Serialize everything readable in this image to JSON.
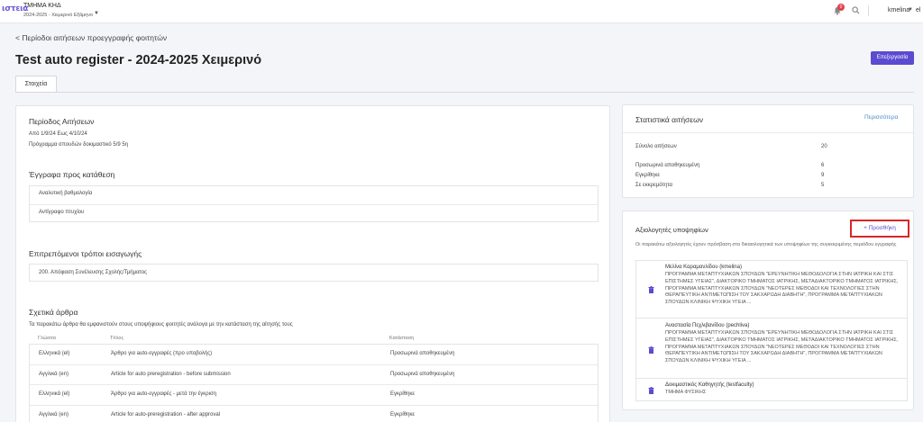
{
  "topnav": {
    "logo": "ιστεια",
    "department": "ΤΜΗΜΑ ΚΗΔ",
    "period": "2024-2025 - Χειμερινό Εξάμηνο",
    "notifications": "0",
    "username": "kmelina",
    "user_extra": "el",
    "icons": {
      "bell": "bell-icon",
      "search": "search-icon"
    }
  },
  "page": {
    "back_link": "Περίοδοι αιτήσεων προεγγραφής φοιτητών",
    "title": "Test auto register - 2024-2025 Χειμερινό",
    "action_button": "Επεξεργασία",
    "tab": "Στοιχεία"
  },
  "left": {
    "period_title": "Περίοδος Αιτήσεων",
    "period_dates": "Από 1/9/24 Εως 4/10/24",
    "program": "Πρόγραμμα σπουδών δοκιμαστικό 5/9 5η",
    "docs_title": "Έγγραφα προς κατάθεση",
    "docs": [
      "Αναλυτική βαθμολογία",
      "Αντίγραφο πτυχίου"
    ],
    "entry_title": "Επιτρεπόμενοι τρόποι εισαγωγής",
    "entry_items": [
      "200. Απόφαση Συνέλευσης Σχολής/Τμήματος"
    ],
    "articles_title": "Σχετικά άρθρα",
    "articles_desc": "Τα παρακάτω άρθρα θα εμφανιστούν στους υποψήφιους φοιτητές ανάλογα με την κατάσταση της αίτησής τους",
    "articles_headers": [
      "Γλώσσα",
      "Τίτλος",
      "Κατάσταση"
    ],
    "articles": [
      [
        "Ελληνικά (el)",
        "Άρθρο για auto-εγγραφές (προ υποβολής)",
        "Προσωρινά αποθηκευμένη"
      ],
      [
        "Αγγλικά (en)",
        "Article for auto preregistration - before submission",
        "Προσωρινά αποθηκευμένη"
      ],
      [
        "Ελληνικά (el)",
        "Άρθρο για auto-εγγραφές - μετά την έγκριση",
        "Εγκρίθηκε"
      ],
      [
        "Αγγλικά (en)",
        "Article for auto-preregistration - after approval",
        "Εγκρίθηκε"
      ]
    ]
  },
  "stats": {
    "title": "Στατιστικά αιτήσεων",
    "more": "Περισσότερα",
    "rows": [
      {
        "label": "Σύνολο αιτήσεων",
        "value": "20"
      },
      {
        "label": "Προσωρινά αποθηκευμένη",
        "value": "6"
      },
      {
        "label": "Εγκρίθηκε",
        "value": "9"
      },
      {
        "label": "Σε εκκρεμότητα",
        "value": "5"
      }
    ]
  },
  "evaluators": {
    "title": "Αξιολογητές υποψηφίων",
    "add": "+ Προσθήκη",
    "desc": "Οι παρακάτω αξιολογητές έχουν πρόσβαση στα δικαιολογητικά των υποψηφίων της συγκεκριμένης περιόδου εγγραφής",
    "items": [
      {
        "name": "Μελίνα Καραμανλίδου (kmelina)",
        "desc": "ΠΡΟΓΡΑΜΜΑ ΜΕΤΑΠΤΥΧΙΑΚΩΝ ΣΠΟΥΔΩΝ \"ΕΡΕΥΝΗΤΙΚΗ ΜΕΘΟΔΟΛΟΓΙΑ ΣΤΗΝ ΙΑΤΡΙΚΗ ΚΑΙ ΣΤΙΣ ΕΠΙΣΤΗΜΕΣ ΥΓΕΙΑΣ\", ΔΙΑΚΤΟΡΙΚΟ ΤΜΗΜΑΤΟΣ ΙΑΤΡΙΚΗΣ, ΜΕΤΑΔΙΑΚΤΟΡΙΚΟ ΤΜΗΜΑΤΟΣ ΙΑΤΡΙΚΗΣ, ΠΡΟΓΡΑΜΜΑ ΜΕΤΑΠΤΥΧΙΑΚΩΝ ΣΠΟΥΔΩΝ \"ΝΕΟΤΕΡΕΣ ΜΕΘΟΔΟΙ ΚΑΙ ΤΕΧΝΟΛΟΓΙΕΣ ΣΤΗΝ ΘΕΡΑΠΕΥΤΙΚΗ ΑΝΤΙΜΕΤΩΠΙΣΗ ΤΟΥ ΣΑΚΧΑΡΩΔΗ ΔΙΑΒΗΤΗ\", ΠΡΟΓΡΑΜΜΑ ΜΕΤΑΠΤΥΧΙΑΚΩΝ ΣΠΟΥΔΩΝ ΚΛΙΝΙΚΗ ΨΥΧΙΚΗ ΥΓΕΙΑ ..."
      },
      {
        "name": "Αναστασία Πεχλιβανίδου (pechliva)",
        "desc": "ΠΡΟΓΡΑΜΜΑ ΜΕΤΑΠΤΥΧΙΑΚΩΝ ΣΠΟΥΔΩΝ \"ΕΡΕΥΝΗΤΙΚΗ ΜΕΘΟΔΟΛΟΓΙΑ ΣΤΗΝ ΙΑΤΡΙΚΗ ΚΑΙ ΣΤΙΣ ΕΠΙΣΤΗΜΕΣ ΥΓΕΙΑΣ\", ΔΙΑΚΤΟΡΙΚΟ ΤΜΗΜΑΤΟΣ ΙΑΤΡΙΚΗΣ, ΜΕΤΑΔΙΑΚΤΟΡΙΚΟ ΤΜΗΜΑΤΟΣ ΙΑΤΡΙΚΗΣ, ΠΡΟΓΡΑΜΜΑ ΜΕΤΑΠΤΥΧΙΑΚΩΝ ΣΠΟΥΔΩΝ \"ΝΕΟΤΕΡΕΣ ΜΕΘΟΔΟΙ ΚΑΙ ΤΕΧΝΟΛΟΓΙΕΣ ΣΤΗΝ ΘΕΡΑΠΕΥΤΙΚΗ ΑΝΤΙΜΕΤΩΠΙΣΗ ΤΟΥ ΣΑΚΧΑΡΩΔΗ ΔΙΑΒΗΤΗ\", ΠΡΟΓΡΑΜΜΑ ΜΕΤΑΠΤΥΧΙΑΚΩΝ ΣΠΟΥΔΩΝ ΚΛΙΝΙΚΗ ΨΥΧΙΚΗ ΥΓΕΙΑ ..."
      },
      {
        "name": "Δοκιμαστικός Καθηγητής (testfaculty)",
        "desc": "ΤΜΗΜΑ ΦΥΣΙΚΗΣ"
      }
    ]
  },
  "colors": {
    "accent": "#5a4bd1",
    "link": "#4a8ac8",
    "highlight": "#d8262b"
  }
}
